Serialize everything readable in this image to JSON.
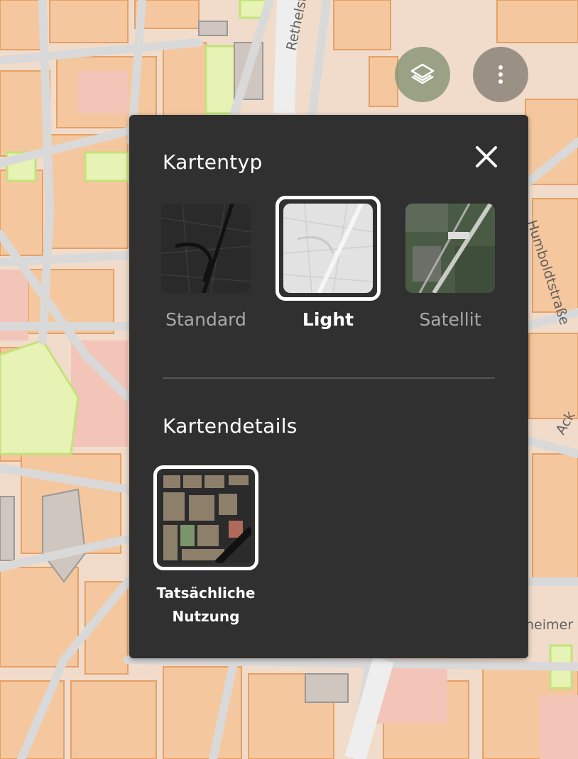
{
  "map": {
    "street_labels": [
      "Rethelstraße",
      "Humboldtstraße",
      "heimer",
      "Ack"
    ]
  },
  "fab": {
    "layers_icon": "layers-icon",
    "more_icon": "more-vertical-icon"
  },
  "panel": {
    "map_type_heading": "Kartentyp",
    "close_icon": "close-icon",
    "map_types": [
      {
        "label": "Standard",
        "selected": false
      },
      {
        "label": "Light",
        "selected": true
      },
      {
        "label": "Satellit",
        "selected": false
      }
    ],
    "details_heading": "Kartendetails",
    "details": [
      {
        "label": "Tatsächliche Nutzung",
        "selected": true
      }
    ]
  },
  "colors": {
    "panel_bg": "#303030",
    "map_building": "#f4c69b",
    "map_green": "#e4f2b4",
    "map_pink": "#f3c4b8"
  }
}
